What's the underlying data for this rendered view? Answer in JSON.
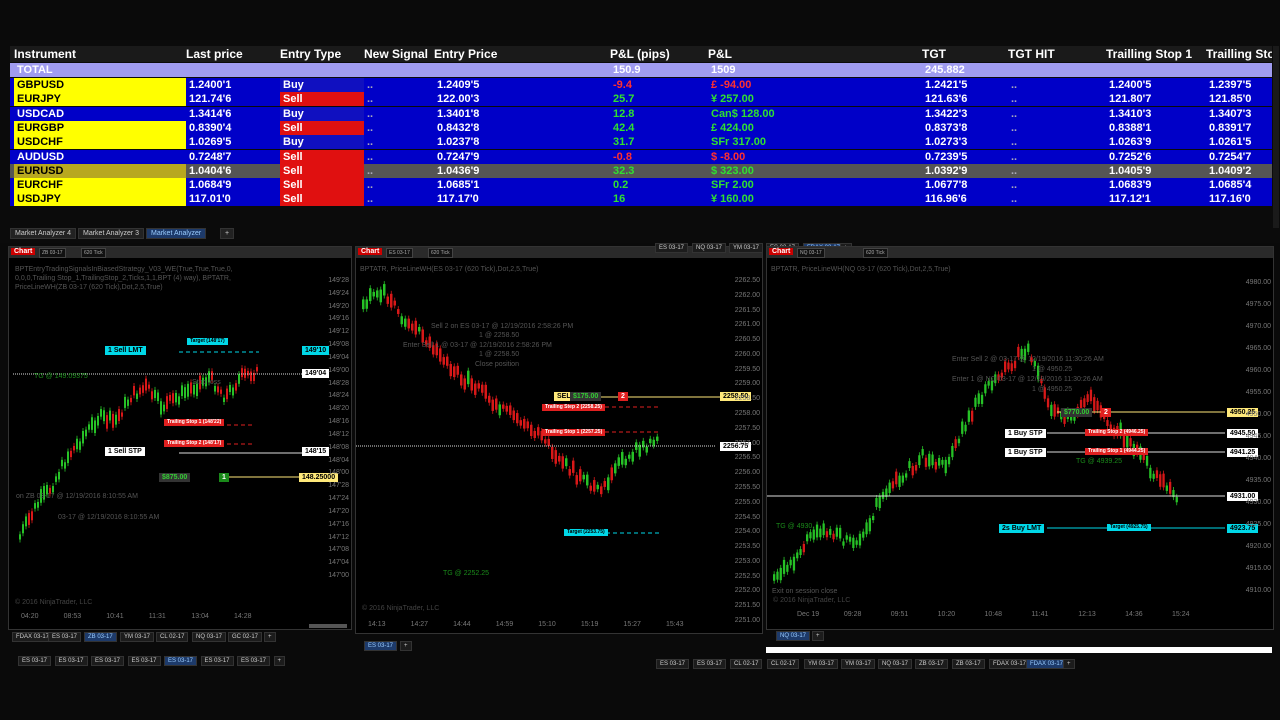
{
  "analyzer": {
    "columns": [
      "Instrument",
      "Last price",
      "Entry Type",
      "New Signal",
      "Entry Price",
      "P&L (pips)",
      "P&L",
      "TGT",
      "TGT HIT",
      "Trailling Stop 1",
      "Trailling Sto"
    ],
    "total": {
      "label": "TOTAL",
      "pips": "150.9",
      "pnl": "1509",
      "tgt": "245.882"
    },
    "rows": [
      {
        "inst": "GBPUSD",
        "last": "1.2400'1",
        "type": "Buy",
        "sig": "..",
        "entry": "1.2409'5",
        "pips": "-9.4",
        "pnl": "£ -94.00",
        "tgt": "1.2421'5",
        "hit": "..",
        "ts1": "1.2400'5",
        "ts2": "1.2397'5"
      },
      {
        "inst": "EURJPY",
        "last": "121.74'6",
        "type": "Sell",
        "sig": "..",
        "entry": "122.00'3",
        "pips": "25.7",
        "pnl": "¥ 257.00",
        "tgt": "121.63'6",
        "hit": "..",
        "ts1": "121.80'7",
        "ts2": "121.85'0"
      },
      {
        "inst": "USDCAD",
        "last": "1.3414'6",
        "type": "Buy",
        "sig": "..",
        "entry": "1.3401'8",
        "pips": "12.8",
        "pnl": "Can$ 128.00",
        "tgt": "1.3422'3",
        "hit": "..",
        "ts1": "1.3410'3",
        "ts2": "1.3407'3"
      },
      {
        "inst": "EURGBP",
        "last": "0.8390'4",
        "type": "Sell",
        "sig": "..",
        "entry": "0.8432'8",
        "pips": "42.4",
        "pnl": "£ 424.00",
        "tgt": "0.8373'8",
        "hit": "..",
        "ts1": "0.8388'1",
        "ts2": "0.8391'7"
      },
      {
        "inst": "USDCHF",
        "last": "1.0269'5",
        "type": "Buy",
        "sig": "..",
        "entry": "1.0237'8",
        "pips": "31.7",
        "pnl": "SFr 317.00",
        "tgt": "1.0273'3",
        "hit": "..",
        "ts1": "1.0263'9",
        "ts2": "1.0261'5"
      },
      {
        "inst": "AUDUSD",
        "last": "0.7248'7",
        "type": "Sell",
        "sig": "..",
        "entry": "0.7247'9",
        "pips": "-0.8",
        "pnl": "$ -8.00",
        "tgt": "0.7239'5",
        "hit": "..",
        "ts1": "0.7252'6",
        "ts2": "0.7254'7"
      },
      {
        "inst": "EURUSD",
        "last": "1.0404'6",
        "type": "Sell",
        "sig": "..",
        "entry": "1.0436'9",
        "pips": "32.3",
        "pnl": "$ 323.00",
        "tgt": "1.0392'9",
        "hit": "..",
        "ts1": "1.0405'9",
        "ts2": "1.0409'2"
      },
      {
        "inst": "EURCHF",
        "last": "1.0684'9",
        "type": "Sell",
        "sig": "..",
        "entry": "1.0685'1",
        "pips": "0.2",
        "pnl": "SFr 2.00",
        "tgt": "1.0677'8",
        "hit": "..",
        "ts1": "1.0683'9",
        "ts2": "1.0685'4"
      },
      {
        "inst": "USDJPY",
        "last": "117.01'0",
        "type": "Sell",
        "sig": "..",
        "entry": "117.17'0",
        "pips": "16",
        "pnl": "¥ 160.00",
        "tgt": "116.96'6",
        "hit": "..",
        "ts1": "117.12'1",
        "ts2": "117.16'0"
      }
    ],
    "tabs": [
      "Market Analyzer 4",
      "Market Analyzer 3",
      "Market Analyzer"
    ]
  },
  "chart1": {
    "chart_label": "Chart",
    "instrument": "ZB 03-17",
    "period": "620 Tick",
    "indicator": "BPTEntryTradingSignalsInBiasedStrategy_V03_WE(True,True,True,0,\n0,0,0,Trailing Stop_1,TrailingStop_2,Ticks,1,1,BPT (4) way), BPTATR,\nPriceLineWH(ZB 03-17 (620 Tick),Dot,2,5,True)",
    "yticks": [
      "149'28",
      "149'24",
      "149'20",
      "149'16",
      "149'12",
      "149'08",
      "149'04",
      "149'00",
      "148'28",
      "148'24",
      "148'20",
      "148'16",
      "148'12",
      "148'08",
      "148'04",
      "148'00",
      "147'28",
      "147'24",
      "147'20",
      "147'16",
      "147'12",
      "147'08",
      "147'04",
      "147'00"
    ],
    "xticks": [
      "04:20",
      "08:53",
      "10:41",
      "11:31",
      "13:04",
      "14:28"
    ],
    "labels": {
      "sell_lmt": "1 Sell LMT",
      "target": "Target (148'17)",
      "price_149_10": "149'10",
      "price_149_04": "149'04",
      "sell_stp": "1 Sell STP",
      "price_148_15": "148'15",
      "pnl": "$875.00",
      "qty": "1",
      "price_148_25": "148.25000",
      "ts1": "Trailing Stop 1 (148'22)",
      "ts2": "Trailing Stop 2 (148'17)",
      "tg": "TG @ 149.09375",
      "stoploss": "Stop loss",
      "entry_info": "on ZB 03-17 @ 12/19/2016 8:10:55 AM",
      "entry_info2": "03-17 @ 12/19/2016 8:10:55 AM",
      "copyright": "© 2016 NinjaTrader, LLC"
    }
  },
  "chart2": {
    "chart_label": "Chart",
    "instrument": "ES 03-17",
    "period": "620 Tick",
    "indicator": "BPTATR, PriceLineWH(ES 03-17 (620 Tick),Dot,2,5,True)",
    "yticks": [
      "2262.50",
      "2262.00",
      "2261.50",
      "2261.00",
      "2260.50",
      "2260.00",
      "2259.50",
      "2259.00",
      "2258.50",
      "2258.00",
      "2257.50",
      "2257.00",
      "2256.50",
      "2256.00",
      "2255.50",
      "2255.00",
      "2254.50",
      "2254.00",
      "2253.50",
      "2253.00",
      "2252.50",
      "2252.00",
      "2251.50",
      "2251.00"
    ],
    "xticks": [
      "14:13",
      "14:27",
      "14:44",
      "14:59",
      "15:10",
      "15:19",
      "15:27",
      "15:43"
    ],
    "labels": {
      "sell_label": "SELL",
      "pnl": "$175.00",
      "qty": "2",
      "price_2258": "2258.50",
      "price_2256": "2256.75",
      "ts2": "Trailing Step 2 (2258.25)",
      "ts1": "Trailing Stop 1 (2257.25)",
      "target": "Target (2253.75)",
      "tg": "TG @ 2252.25",
      "sell2": "Sell 2 on ES 03-17 @ 12/19/2016 2:58:26 PM",
      "sell2b": "1 @ 2258.50",
      "enter": "Enter Sell 1 @ 03-17 @ 12/19/2016 2:58:26 PM",
      "enterb": "1 @ 2258.50",
      "close": "Close position",
      "copyright": "© 2016 NinjaTrader, LLC"
    },
    "tabs_top": [
      "ES 03-17",
      "NQ 03-17",
      "YM 03-17",
      "ES 03-17",
      "FDAX 03-17"
    ]
  },
  "chart3": {
    "chart_label": "Chart",
    "instrument": "NQ 03-17",
    "period": "620 Tick",
    "indicator": "BPTATR, PriceLineWH(NQ 03-17 (620 Tick),Dot,2,5,True)",
    "yticks": [
      "4980.00",
      "4975.00",
      "4970.00",
      "4965.00",
      "4960.00",
      "4955.00",
      "4950.00",
      "4945.00",
      "4940.00",
      "4935.00",
      "4930.00",
      "4925.00",
      "4920.00",
      "4915.00",
      "4910.00"
    ],
    "xticks": [
      "Dec 19",
      "09:28",
      "09:51",
      "10:20",
      "10:48",
      "11:41",
      "12:13",
      "14:36",
      "15:24"
    ],
    "labels": {
      "price_4950": "4950.25",
      "buy_stp1": "1 Buy STP",
      "price_4945": "4945.50",
      "buy_stp2": "1 Buy STP",
      "price_4941": "4941.25",
      "price_4931": "4931.00",
      "buy_lmt": "2s Buy LMT",
      "price_4923": "4923.75",
      "pnl": "$770.00",
      "qty": "2",
      "ts2": "Trailing Stop 2 (4946.25)",
      "ts1": "Trailing Stop 1 (4944.25)",
      "target": "Target (4925.75)",
      "tg": "TG @ 4939.25",
      "tg2": "TG @ 4930.",
      "enter": "Enter Sell 2 @ 03-17 @ 12/19/2016 11:30:26 AM",
      "enterb": "1 @ 4950.25",
      "enter2": "Enter 1 @ NQ 03-17 @ 12/19/2016 11:30:26 AM",
      "enter2b": "1 @ 4950.25",
      "exit": "Exit on session close",
      "copyright": "© 2016 NinjaTrader, LLC"
    }
  },
  "bottom_tabs_left": [
    "FDAX 03-17",
    "ES 03-17",
    "ZB 03-17",
    "YM 03-17",
    "CL 02-17",
    "NQ 03-17",
    "GC 02-17"
  ],
  "bottom_tabs_left2": [
    "ES 03-17",
    "ES 03-17",
    "ES 03-17",
    "ES 03-17",
    "ES 03-17",
    "ES 03-17",
    "ES 03-17"
  ],
  "bottom_tabs_mid": [
    "ES 03-17"
  ],
  "bottom_tabs_right": [
    "NQ 03-17"
  ],
  "bottom_tabs_right2": [
    "ES 03-17",
    "ES 03-17",
    "CL 02-17",
    "CL 02-17",
    "YM 03-17",
    "YM 03-17",
    "NQ 03-17",
    "ZB 03-17",
    "ZB 03-17",
    "FDAX 03-17",
    "FDAX 03-17"
  ],
  "colors": {
    "pos": "#30e030",
    "neg": "#ff3030",
    "accent_blue": "#0000c8",
    "total_bg": "#a09cf0"
  }
}
